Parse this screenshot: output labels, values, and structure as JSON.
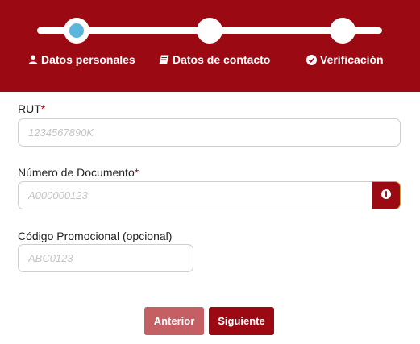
{
  "steps": [
    {
      "label": "Datos personales",
      "icon": "user-icon",
      "active": true
    },
    {
      "label": "Datos de contacto",
      "icon": "book-icon",
      "active": false
    },
    {
      "label": "Verificación",
      "icon": "check-circle-icon",
      "active": false
    }
  ],
  "fields": {
    "rut": {
      "label": "RUT",
      "required_mark": "*",
      "placeholder": "1234567890K",
      "value": ""
    },
    "documento": {
      "label": "Número de Documento",
      "required_mark": "*",
      "placeholder": "A000000123",
      "value": "",
      "info_icon": "info-icon"
    },
    "codigo": {
      "label": "Código Promocional (opcional)",
      "placeholder": "ABC0123",
      "value": ""
    }
  },
  "buttons": {
    "previous": "Anterior",
    "next": "Siguiente"
  },
  "colors": {
    "primary": "#9b0a12",
    "primary_light": "#c46064",
    "active_step": "#5bb6de",
    "info_border": "#d4a23a"
  }
}
